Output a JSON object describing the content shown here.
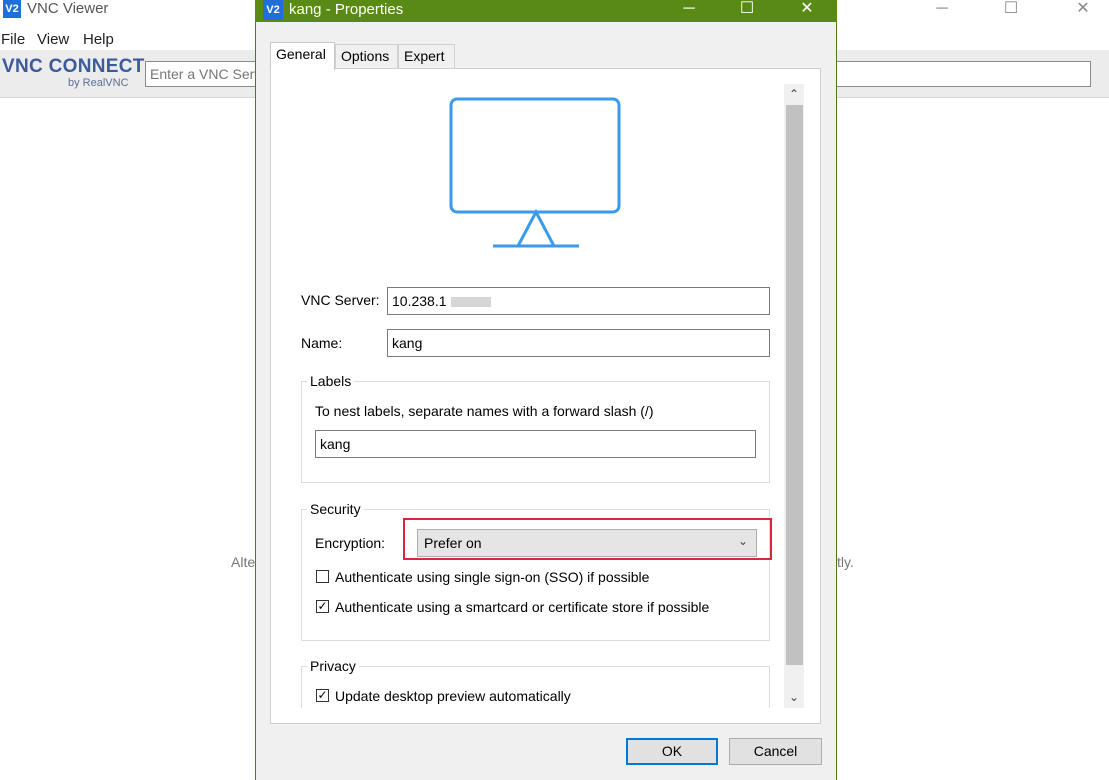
{
  "background_window": {
    "title": "VNC Viewer",
    "app_icon": "V2",
    "menu": [
      "File",
      "View",
      "Help"
    ],
    "brand": "VNC CONNECT",
    "brand_sub": "by RealVNC",
    "search_placeholder": "Enter a VNC Server address or search",
    "hint_left": "Alte",
    "hint_right": "ctly."
  },
  "dialog": {
    "title": "kang - Properties",
    "icon": "V2",
    "controls": {
      "minimize": "─",
      "maximize": "☐",
      "close": "✕"
    },
    "tabs": [
      "General",
      "Options",
      "Expert"
    ],
    "active_tab": "General",
    "icons": {
      "monitor": "monitor-icon"
    },
    "vnc_server": {
      "label": "VNC Server:",
      "value": "10.238.1"
    },
    "name": {
      "label": "Name:",
      "value": "kang"
    },
    "labels_group": {
      "title": "Labels",
      "hint": "To nest labels, separate names with a forward slash (/)",
      "value": "kang"
    },
    "security": {
      "title": "Security",
      "encryption_label": "Encryption:",
      "encryption_value": "Prefer on",
      "sso": {
        "label": "Authenticate using single sign-on (SSO) if possible",
        "checked": false
      },
      "smartcard": {
        "label": "Authenticate using a smartcard or certificate store if possible",
        "checked": true
      }
    },
    "privacy": {
      "title": "Privacy",
      "update_preview": {
        "label": "Update desktop preview automatically",
        "checked": true
      }
    },
    "buttons": {
      "ok": "OK",
      "cancel": "Cancel"
    },
    "highlight_color": "#d9263a",
    "titlebar_color": "#5a8a16"
  }
}
